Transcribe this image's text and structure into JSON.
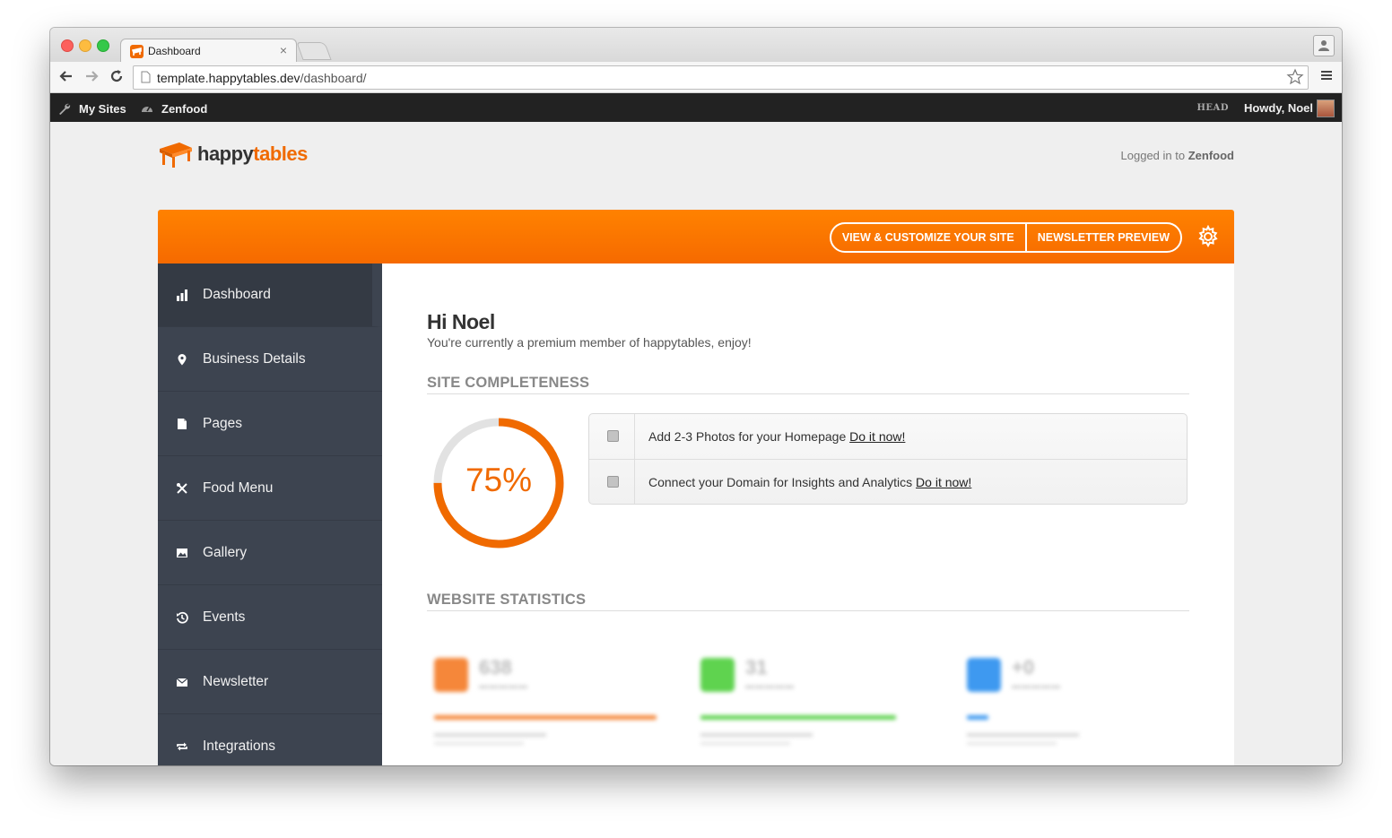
{
  "browser": {
    "tab_title": "Dashboard",
    "tab_close": "×",
    "url_host": "template.happytables.dev",
    "url_path": "/dashboard/"
  },
  "adminbar": {
    "my_sites": "My Sites",
    "site_name": "Zenfood",
    "branch": "HEAD",
    "howdy": "Howdy, Noel"
  },
  "brand": {
    "happy": "happy",
    "tables": "tables",
    "accent": "#f06a00"
  },
  "header": {
    "logged_in_prefix": "Logged in to",
    "logged_in_site": "Zenfood",
    "view_customize": "VIEW & CUSTOMIZE YOUR SITE",
    "newsletter_preview": "NEWSLETTER PREVIEW",
    "settings_icon": "gear-icon"
  },
  "sidebar": {
    "items": [
      {
        "label": "Dashboard",
        "icon": "bar-chart-icon",
        "active": true
      },
      {
        "label": "Business Details",
        "icon": "map-pin-icon",
        "active": false
      },
      {
        "label": "Pages",
        "icon": "document-icon",
        "active": false
      },
      {
        "label": "Food Menu",
        "icon": "utensils-icon",
        "active": false
      },
      {
        "label": "Gallery",
        "icon": "image-icon",
        "active": false
      },
      {
        "label": "Events",
        "icon": "history-icon",
        "active": false
      },
      {
        "label": "Newsletter",
        "icon": "envelope-icon",
        "active": false
      },
      {
        "label": "Integrations",
        "icon": "sync-icon",
        "active": false
      }
    ]
  },
  "main": {
    "greeting": "Hi Noel",
    "subtitle": "You're currently a premium member of happytables, enjoy!",
    "completeness_title": "SITE COMPLETENESS",
    "completeness_percent": 75,
    "completeness_label": "75%",
    "tasks": [
      {
        "text": "Add 2-3 Photos for your Homepage",
        "link": "Do it now!"
      },
      {
        "text": "Connect your Domain for Insights and Analytics",
        "link": "Do it now!"
      }
    ],
    "stats_title": "WEBSITE STATISTICS",
    "stats": [
      {
        "value": "638",
        "color": "#f5873a"
      },
      {
        "value": "31",
        "color": "#5fd34f"
      },
      {
        "value": "+0",
        "color": "#3e99f0"
      }
    ]
  }
}
